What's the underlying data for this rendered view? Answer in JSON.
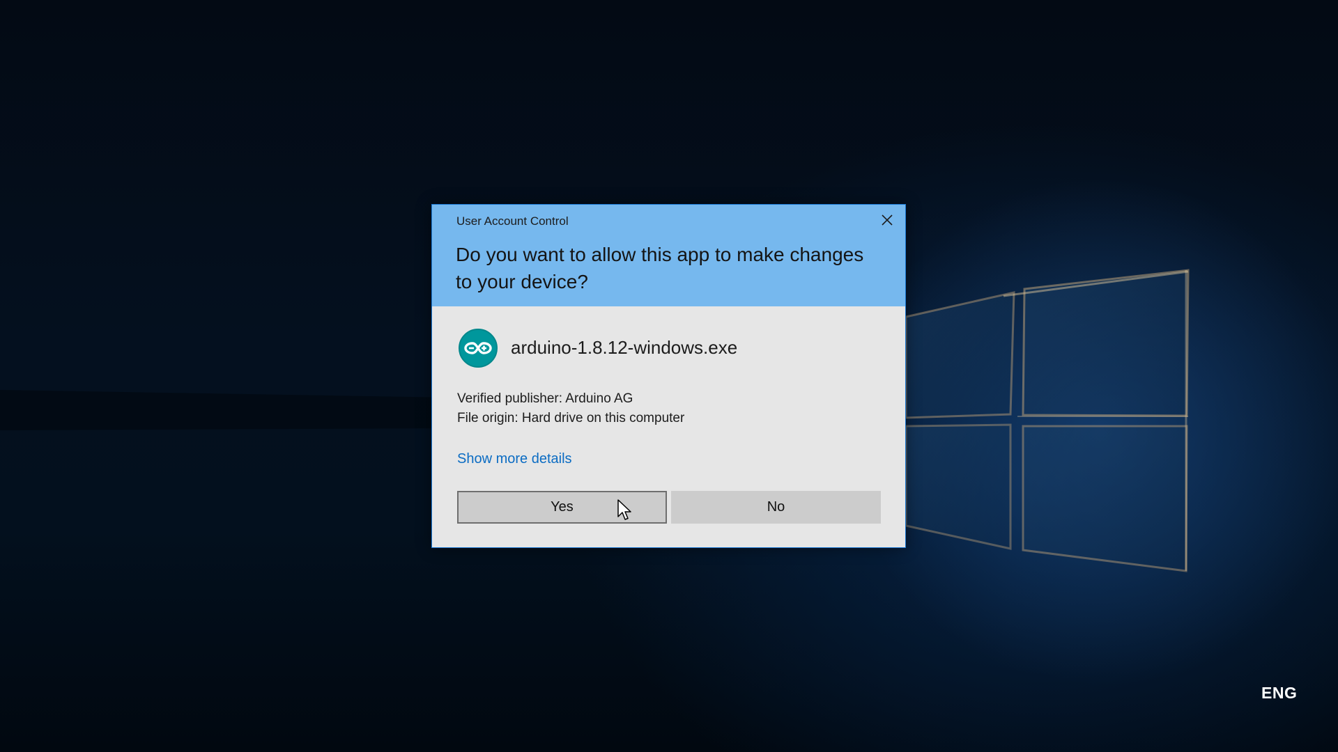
{
  "taskbar": {
    "language": "ENG"
  },
  "dialog": {
    "title": "User Account Control",
    "question": "Do you want to allow this app to make changes to your device?",
    "app_name": "arduino-1.8.12-windows.exe",
    "app_icon": "arduino-icon",
    "publisher_line": "Verified publisher: Arduino AG",
    "origin_line": "File origin: Hard drive on this computer",
    "details_link": "Show more details",
    "yes_label": "Yes",
    "no_label": "No",
    "close_icon": "close-icon"
  },
  "colors": {
    "header": "#76b8ee",
    "body": "#e6e6e6",
    "link": "#0b6cc3",
    "border": "#1a78d4",
    "button": "#cccccc",
    "arduino_teal": "#00979c"
  }
}
